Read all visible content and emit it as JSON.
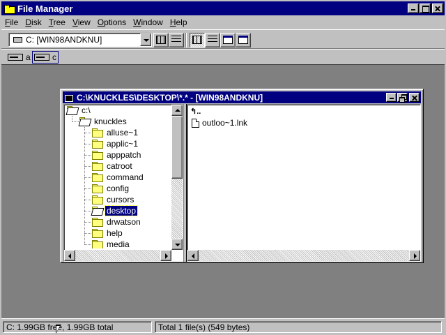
{
  "window": {
    "title": "File Manager"
  },
  "menu": [
    {
      "label": "File",
      "underline": "F",
      "rest": "ile",
      "name": "menu-file"
    },
    {
      "label": "Disk",
      "underline": "D",
      "rest": "isk",
      "name": "menu-disk"
    },
    {
      "label": "Tree",
      "underline": "T",
      "rest": "ree",
      "name": "menu-tree"
    },
    {
      "label": "View",
      "underline": "V",
      "rest": "iew",
      "name": "menu-view"
    },
    {
      "label": "Options",
      "underline": "O",
      "rest": "ptions",
      "name": "menu-options"
    },
    {
      "label": "Window",
      "underline": "W",
      "rest": "indow",
      "name": "menu-window"
    },
    {
      "label": "Help",
      "underline": "H",
      "rest": "elp",
      "name": "menu-help"
    }
  ],
  "toolbar": {
    "drive_select_value": "C: [WIN98ANDKNU]",
    "icons": [
      "connect-drive-icon",
      "disconnect-drive-icon",
      "large-icons-view-icon",
      "details-view-icon",
      "sort-by-name-icon",
      "sort-by-type-icon",
      "new-window-icon",
      "cascade-icon"
    ]
  },
  "drives": [
    {
      "letter": "a",
      "icon": "floppy-drive-icon",
      "selected": false
    },
    {
      "letter": "c",
      "icon": "hard-drive-icon",
      "selected": true
    }
  ],
  "child_window": {
    "title": "C:\\KNUCKLES\\DESKTOP\\*.* - [WIN98ANDKNU]",
    "tree": {
      "root": "c:\\",
      "parent": "knuckles",
      "children": [
        "alluse~1",
        "applic~1",
        "apppatch",
        "catroot",
        "command",
        "config",
        "cursors",
        "desktop",
        "drwatson",
        "help",
        "media"
      ],
      "selected": "desktop"
    },
    "files": [
      {
        "name": "",
        "icon": "up-directory-icon"
      },
      {
        "name": "outloo~1.lnk",
        "icon": "document-icon"
      }
    ]
  },
  "status": {
    "disk_space": "C: 1.99GB free,  1.99GB total",
    "file_summary": "Total 1 file(s) (549 bytes)"
  }
}
